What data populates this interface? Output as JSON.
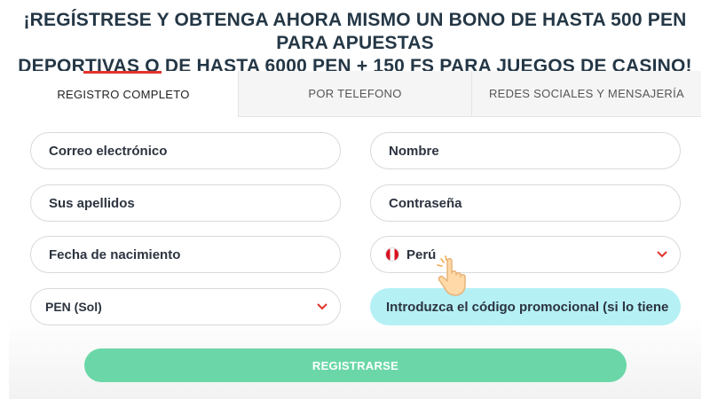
{
  "headline": {
    "line1": "¡REGÍSTRESE Y OBTENGA AHORA MISMO UN BONO DE HASTA 500 PEN PARA APUESTAS",
    "line2": "DEPORTIVAS O DE HASTA 6000 PEN + 150 FS PARA JUEGOS DE CASINO!"
  },
  "tabs": [
    {
      "label": "REGISTRO COMPLETO",
      "active": true
    },
    {
      "label": "POR TELEFONO",
      "active": false
    },
    {
      "label": "REDES SOCIALES Y MENSAJERÍA",
      "active": false
    }
  ],
  "form": {
    "email": "Correo electrónico",
    "first_name": "Nombre",
    "last_name": "Sus apellidos",
    "password": "Contraseña",
    "birth_date": "Fecha de nacimiento",
    "country": "Perú",
    "currency": "PEN (Sol)",
    "promo_code": "Introduzca el código promocional (si lo tiene"
  },
  "submit_label": "REGISTRARSE",
  "colors": {
    "accent": "#e3322b",
    "submit": "#6bd7a8",
    "promo_bg": "#b5f0f5",
    "chevron": "#e3322b"
  },
  "icons": [
    "peru-flag-icon",
    "chevron-down-icon",
    "pointer-hand-icon"
  ]
}
